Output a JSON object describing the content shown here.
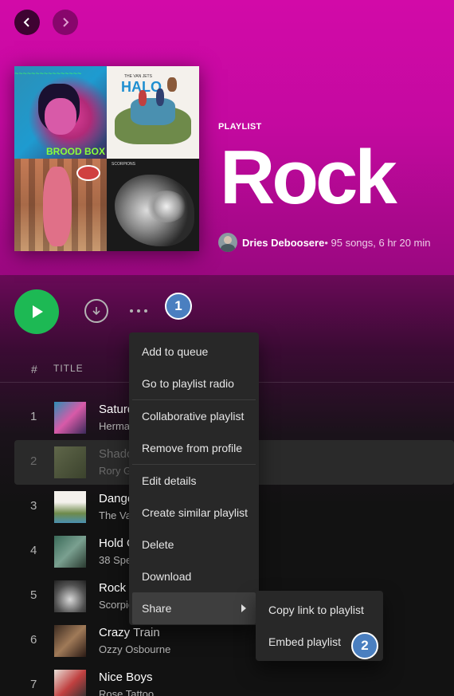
{
  "navigation": {
    "back_label": "back",
    "forward_label": "forward"
  },
  "cover": {
    "tiles": [
      "Rrood Box",
      "The Vaccines Halo",
      "Rory Gallagher Wild Eyed",
      "Scorpions Love"
    ],
    "texts": {
      "brood_box": "BROOD BOX",
      "halo": "HALO",
      "vanjets": "THE VAN JETS",
      "scorpions": "SCORPIONS"
    }
  },
  "playlist": {
    "type_label": "PLAYLIST",
    "title": "Rock",
    "owner": "Dries Deboosere",
    "info": " • 95 songs, 6 hr 20 min"
  },
  "controls": {
    "badge1": "1",
    "badge2": "2"
  },
  "columns": {
    "hash": "#",
    "title": "TITLE"
  },
  "tracks": [
    {
      "num": "1",
      "name": "Saturday Night",
      "artist": "Herman Dune, Brood Box · Dance"
    },
    {
      "num": "2",
      "name": "Shadow Play",
      "artist": "Rory Gallagher"
    },
    {
      "num": "3",
      "name": "Danger! High Voltage",
      "artist": "The Van Jets"
    },
    {
      "num": "4",
      "name": "Hold On Loosely",
      "artist": "38 Special"
    },
    {
      "num": "5",
      "name": "Rock You Like a Hurricane",
      "artist": "Scorpions"
    },
    {
      "num": "6",
      "name": "Crazy Train",
      "artist": "Ozzy Osbourne"
    },
    {
      "num": "7",
      "name": "Nice Boys",
      "artist": "Rose Tattoo"
    }
  ],
  "context_menu": {
    "items": [
      "Add to queue",
      "Go to playlist radio",
      "Collaborative playlist",
      "Remove from profile",
      "Edit details",
      "Create similar playlist",
      "Delete",
      "Download",
      "Share"
    ]
  },
  "share_submenu": {
    "items": [
      "Copy link to playlist",
      "Embed playlist"
    ]
  },
  "colors": {
    "accent": "#1db954",
    "gradient_top": "#d20aa8",
    "badge": "#4a7fc0"
  }
}
